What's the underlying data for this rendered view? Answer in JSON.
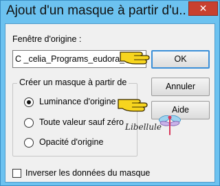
{
  "window": {
    "title": "Ajout d'un masque à partir d'u...",
    "close_glyph": "✕"
  },
  "source": {
    "label": "Fenêtre d'origine :",
    "combo_value": "C _celia_Programs_eudora_"
  },
  "group": {
    "legend": "Créer un masque à partir de",
    "options": [
      {
        "label": "Luminance d'origine",
        "selected": true
      },
      {
        "label": "Toute valeur sauf zéro",
        "selected": false
      },
      {
        "label": "Opacité d'origine",
        "selected": false
      }
    ]
  },
  "buttons": {
    "ok": "OK",
    "cancel": "Annuler",
    "help": "Aide"
  },
  "invert": {
    "label": "Inverser les données du masque",
    "checked": false
  },
  "decoration": {
    "signature": "Libellule",
    "pointer_icon": "pointing-hand-icon",
    "accent_color": "#6cc2f0",
    "hand_color": "#f7d51e"
  }
}
